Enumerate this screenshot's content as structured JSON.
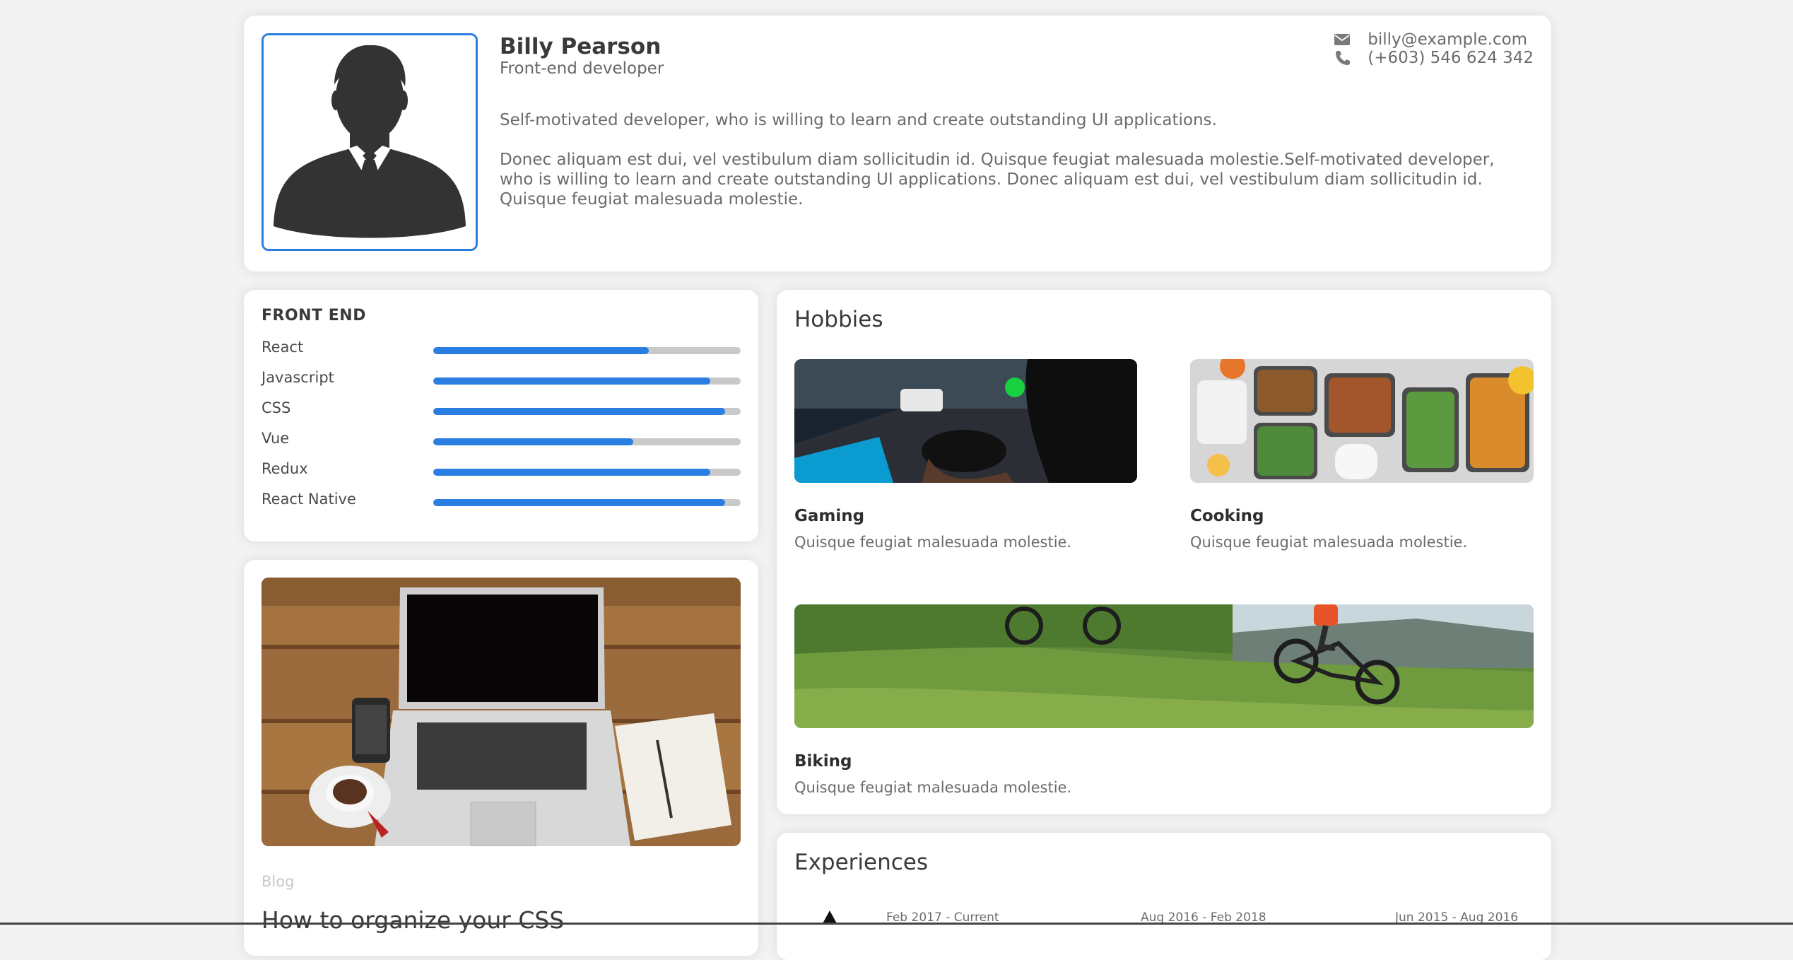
{
  "profile": {
    "name": "Billy Pearson",
    "role": "Front-end developer",
    "email": "billy@example.com",
    "phone": "(+603) 546 624 342",
    "description": [
      "Self-motivated developer, who is willing to learn and create outstanding UI applications.",
      "Donec aliquam est dui, vel vestibulum diam sollicitudin id. Quisque feugiat malesuada molestie.Self-motivated developer, who is willing to learn and create outstanding UI applications. Donec aliquam est dui, vel vestibulum diam sollicitudin id. Quisque feugiat malesuada molestie."
    ]
  },
  "skills": {
    "heading": "FRONT END",
    "items": [
      {
        "label": "React",
        "level": 0.7
      },
      {
        "label": "Javascript",
        "level": 0.9
      },
      {
        "label": "CSS",
        "level": 0.95
      },
      {
        "label": "Vue",
        "level": 0.65
      },
      {
        "label": "Redux",
        "level": 0.9
      },
      {
        "label": "React Native",
        "level": 0.95
      }
    ]
  },
  "blog": {
    "category": "Blog",
    "title": "How to organize your CSS"
  },
  "hobbies": {
    "title": "Hobbies",
    "items": [
      {
        "name": "Gaming",
        "desc": "Quisque feugiat malesuada molestie."
      },
      {
        "name": "Cooking",
        "desc": "Quisque feugiat malesuada molestie."
      },
      {
        "name": "Biking",
        "desc": "Quisque feugiat malesuada molestie."
      }
    ]
  },
  "experiences": {
    "title": "Experiences",
    "dates": [
      "Feb 2017 - Current",
      "Aug 2016 - Feb 2018",
      "Jun 2015 - Aug 2016"
    ]
  },
  "colors": {
    "accent": "#2a7de1",
    "track": "#c9c9c9",
    "background": "#f3f3f3"
  },
  "icons": {
    "email": "envelope-icon",
    "phone": "phone-icon",
    "avatar": "person-silhouette-icon"
  }
}
